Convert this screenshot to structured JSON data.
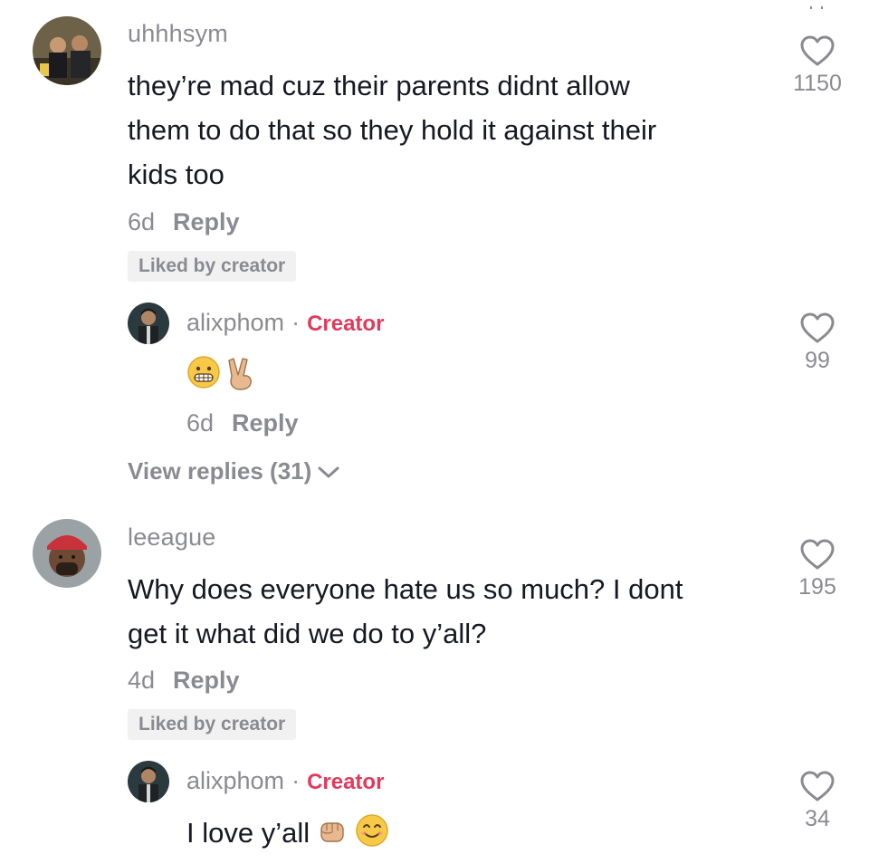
{
  "comments": [
    {
      "username": "uhhhsym",
      "text_lines": [
        "they’re mad cuz their parents didnt allow",
        "them to do that so they hold it against their",
        "kids too"
      ],
      "age": "6d",
      "reply_label": "Reply",
      "liked_by_creator": "Liked by creator",
      "likes": "1150",
      "reply": {
        "username": "alixphom",
        "separator": "·",
        "badge": "Creator",
        "emojis": [
          "grimacing-face",
          "victory-hand"
        ],
        "age": "6d",
        "reply_label": "Reply",
        "likes": "99"
      },
      "view_replies": "View replies (31)"
    },
    {
      "username": "leeague",
      "text_lines": [
        "Why does everyone hate us so much? I dont",
        "get it what did we do to y’all?"
      ],
      "age": "4d",
      "reply_label": "Reply",
      "liked_by_creator": "Liked by creator",
      "likes": "195",
      "reply": {
        "username": "alixphom",
        "separator": "·",
        "badge": "Creator",
        "text": "I love y’all",
        "emojis": [
          "raised-fist",
          "smiling-face"
        ],
        "likes": "34"
      }
    }
  ],
  "colors": {
    "text": "#161823",
    "muted": "#8a8b91",
    "creator": "#e03a5c",
    "chip_bg": "#f1f1f2"
  }
}
